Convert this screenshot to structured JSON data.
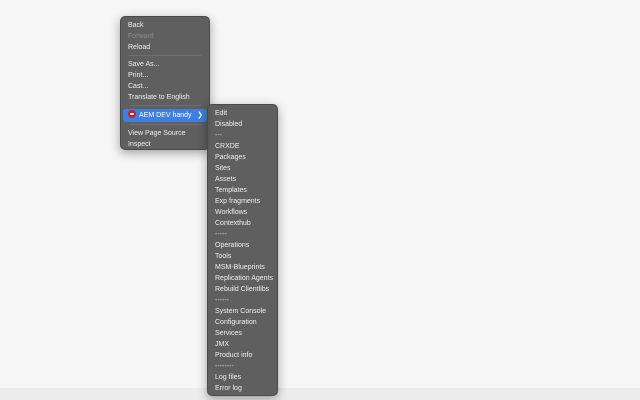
{
  "context_menu": {
    "items": [
      {
        "label": "Back",
        "disabled": false
      },
      {
        "label": "Forward",
        "disabled": true
      },
      {
        "label": "Reload",
        "disabled": false
      },
      {
        "label": "Save As...",
        "disabled": false
      },
      {
        "label": "Print...",
        "disabled": false
      },
      {
        "label": "Cast...",
        "disabled": false
      },
      {
        "label": "Translate to English",
        "disabled": false
      },
      {
        "label": "AEM DEV handy",
        "disabled": false,
        "highlighted": true,
        "icon": "aem-extension-icon"
      },
      {
        "label": "View Page Source",
        "disabled": false
      },
      {
        "label": "Inspect",
        "disabled": false
      }
    ]
  },
  "submenu": {
    "items": [
      "Edit",
      "Disabled",
      "---",
      "CRXDE",
      "Packages",
      "Sites",
      "Assets",
      "Templates",
      "Exp fragments",
      "Workflows",
      "Contexthub",
      "-----",
      "Operations",
      "Tools",
      "MSM-Blueprints",
      "Replication Agents",
      "Rebuild Clientlibs",
      "------",
      "System Console",
      "Configuration",
      "Services",
      "JMX",
      "Product info",
      "--------",
      "Log files",
      "Error log"
    ]
  },
  "colors": {
    "menu_bg": "#585858",
    "highlight": "#3f7fe0",
    "extension_icon": "#c8202a"
  }
}
